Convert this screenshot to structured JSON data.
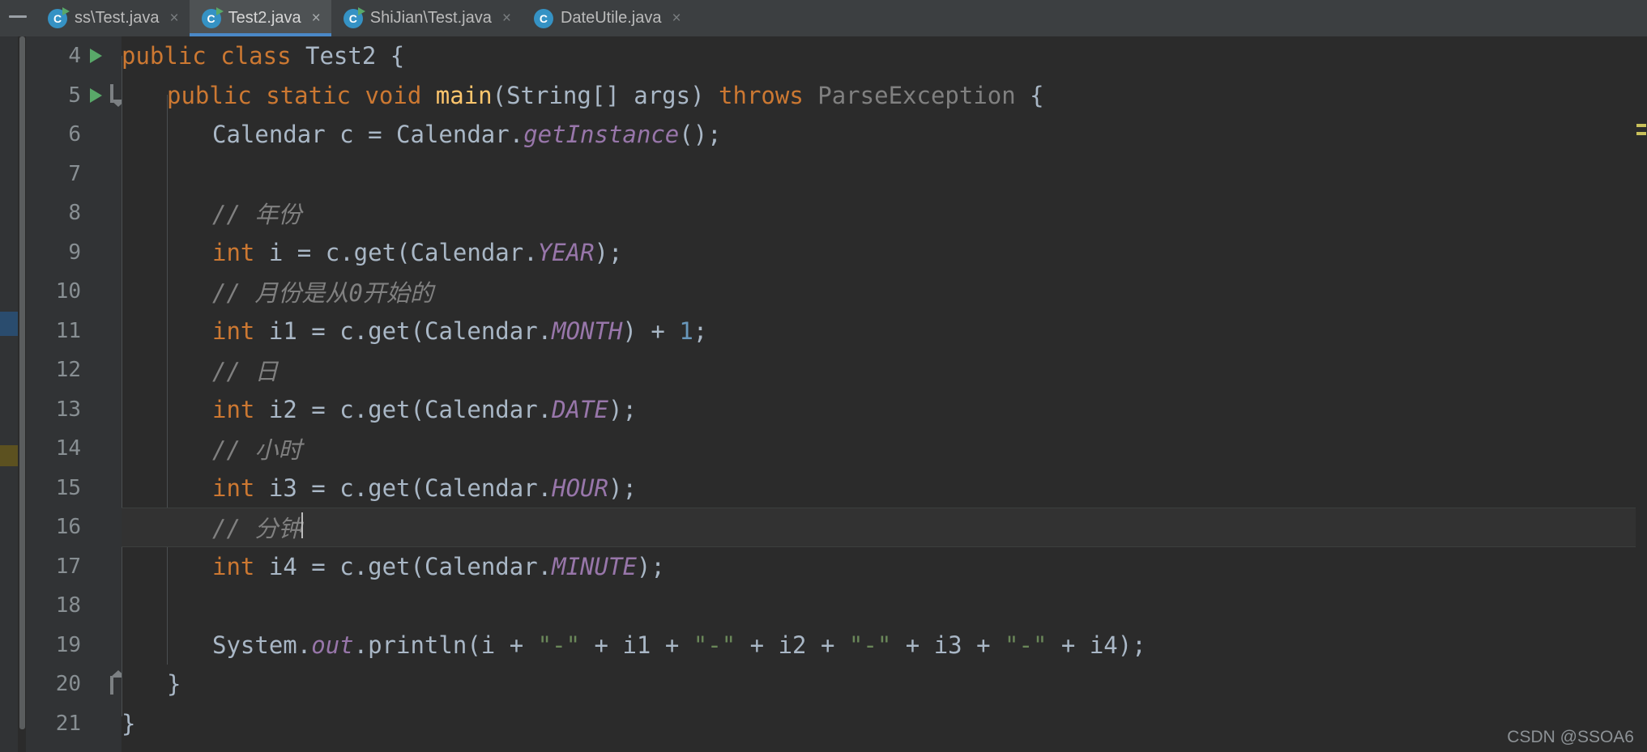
{
  "window": {
    "collapse_icon": "minimize-icon"
  },
  "tabs": [
    {
      "label": "ss\\Test.java",
      "icon": "java-runnable-class-icon",
      "active": false,
      "close": "×"
    },
    {
      "label": "Test2.java",
      "icon": "java-runnable-class-icon",
      "active": true,
      "close": "×"
    },
    {
      "label": "ShiJian\\Test.java",
      "icon": "java-runnable-class-icon",
      "active": false,
      "close": "×"
    },
    {
      "label": "DateUtile.java",
      "icon": "java-class-icon",
      "active": false,
      "close": "×"
    }
  ],
  "editor": {
    "first_line": 4,
    "caret_line": 16,
    "gutter": {
      "run_markers": [
        4,
        5
      ],
      "fold_open": [
        5
      ],
      "fold_close": [
        20
      ]
    },
    "lines": [
      {
        "n": 4,
        "indent": 0
      },
      {
        "n": 5,
        "indent": 1
      },
      {
        "n": 6,
        "indent": 2
      },
      {
        "n": 7,
        "indent": 2
      },
      {
        "n": 8,
        "indent": 2
      },
      {
        "n": 9,
        "indent": 2
      },
      {
        "n": 10,
        "indent": 2
      },
      {
        "n": 11,
        "indent": 2
      },
      {
        "n": 12,
        "indent": 2
      },
      {
        "n": 13,
        "indent": 2
      },
      {
        "n": 14,
        "indent": 2
      },
      {
        "n": 15,
        "indent": 2
      },
      {
        "n": 16,
        "indent": 2
      },
      {
        "n": 17,
        "indent": 2
      },
      {
        "n": 18,
        "indent": 2
      },
      {
        "n": 19,
        "indent": 2
      },
      {
        "n": 20,
        "indent": 1
      },
      {
        "n": 21,
        "indent": 0
      }
    ],
    "code_text": {
      "l4": "public class Test2 {",
      "l5": "public static void main(String[] args) throws ParseException {",
      "l6": "Calendar c = Calendar.getInstance();",
      "l7": "",
      "l8": "// 年份",
      "l9": "int i = c.get(Calendar.YEAR);",
      "l10": "// 月份是从0开始的",
      "l11": "int i1 = c.get(Calendar.MONTH) + 1;",
      "l12": "// 日",
      "l13": "int i2 = c.get(Calendar.DATE);",
      "l14": "// 小时",
      "l15": "int i3 = c.get(Calendar.HOUR);",
      "l16": "// 分钟",
      "l17": "int i4 = c.get(Calendar.MINUTE);",
      "l18": "",
      "l19": "System.out.println(i + \"-\" + i1 + \"-\" + i2 + \"-\" + i3 + \"-\" + i4);",
      "l20": "}",
      "l21": "}"
    },
    "tokens": {
      "kw_public": "public",
      "kw_class": "class",
      "kw_static": "static",
      "kw_void": "void",
      "kw_throws": "throws",
      "kw_int": "int",
      "name_Test2": "Test2",
      "name_main": "main",
      "type_String": "String",
      "arg_args": "args",
      "exc_ParseException": "ParseException",
      "type_Calendar": "Calendar",
      "var_c": "c",
      "meth_getInstance": "getInstance",
      "meth_get": "get",
      "const_YEAR": "YEAR",
      "const_MONTH": "MONTH",
      "const_DATE": "DATE",
      "const_HOUR": "HOUR",
      "const_MINUTE": "MINUTE",
      "var_i": "i",
      "var_i1": "i1",
      "var_i2": "i2",
      "var_i3": "i3",
      "var_i4": "i4",
      "cls_System": "System",
      "field_out": "out",
      "meth_println": "println",
      "num_1": "1",
      "num_0": "0",
      "str_dash": "\"-\"",
      "cmt_year": "// 年份",
      "cmt_month_a": "// 月份是从",
      "cmt_month_b": "开始的",
      "cmt_day": "// 日",
      "cmt_hour": "// 小时",
      "cmt_minute": "// 分钟"
    }
  },
  "watermark": {
    "text": "CSDN @SSOA6"
  },
  "colors": {
    "editor_bg": "#2b2b2b",
    "gutter_bg": "#313335",
    "chrome_bg": "#3c3f41",
    "tab_active_bg": "#4e5254",
    "tab_underline": "#4a88c7",
    "keyword": "#cc7832",
    "method": "#ffc66d",
    "constant": "#9876aa",
    "string": "#6a8759",
    "number": "#6897bb",
    "comment": "#808080",
    "identifier": "#a9b7c6",
    "run_marker": "#59a869",
    "caret_line_bg": "#323232"
  }
}
